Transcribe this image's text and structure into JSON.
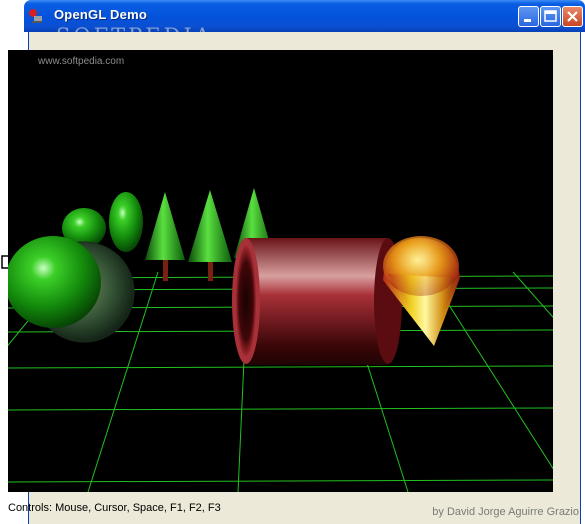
{
  "window": {
    "title": "OpenGL Demo",
    "watermark": "SOFTPEDIA",
    "buttons": {
      "minimize": "minimize-icon",
      "maximize": "maximize-icon",
      "close": "close-icon"
    }
  },
  "viewport": {
    "site_url": "www.softpedia.com",
    "background_color": "#000000",
    "grid_color": "#22c020"
  },
  "status": {
    "controls": "Controls: Mouse, Cursor, Space, F1, F2, F3",
    "author": "by David Jorge Aguirre Grazio"
  }
}
